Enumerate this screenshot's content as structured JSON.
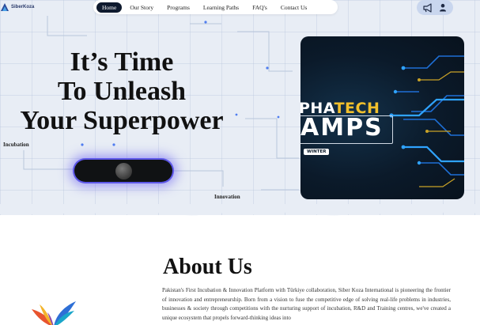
{
  "brand": {
    "name": "SiberKoza"
  },
  "nav": {
    "items": [
      {
        "label": "Home",
        "active": true
      },
      {
        "label": "Our Story",
        "active": false
      },
      {
        "label": "Programs",
        "active": false
      },
      {
        "label": "Learning Paths",
        "active": false
      },
      {
        "label": "FAQ's",
        "active": false
      },
      {
        "label": "Contact Us",
        "active": false
      }
    ],
    "right_icons": [
      "megaphone-icon",
      "user-icon"
    ]
  },
  "hero": {
    "headline_1": "It’s Time",
    "headline_2": "To Unleash",
    "headline_3": "Your Superpower",
    "tag_left": "Incubation",
    "tag_right": "Innovation",
    "banner": {
      "line1_white": "PHA",
      "line1_gold": "TECH",
      "line2": "AMPS",
      "badge": "WINTER"
    }
  },
  "about": {
    "title": "About Us",
    "text": "Pakistan's First Incubation & Innovation Platform with Türkiye collaboration, Siber Koza International is pioneering the frontier of innovation and entrepreneurship. Born from a vision to fuse the competitive edge of solving real-life problems in industries, businesses & society through competitions with the nurturing support of incubation, R&D and Training centres, we've created a unique ecosystem that propels forward-thinking ideas into"
  },
  "colors": {
    "accent_glow": "#5d57e8",
    "nav_active": "#0f1a2e",
    "banner_gold": "#f2c02c",
    "hero_bg": "#e8edf5"
  }
}
